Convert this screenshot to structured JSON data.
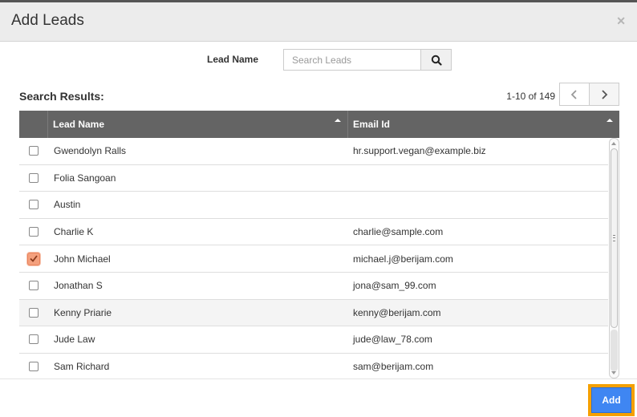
{
  "dialog": {
    "title": "Add Leads",
    "close_icon": "close-icon"
  },
  "search": {
    "label": "Lead Name",
    "placeholder": "Search Leads",
    "value": "",
    "button_icon": "search-icon"
  },
  "results": {
    "title": "Search Results:",
    "pagination": "1-10 of 149",
    "prev_icon": "chevron-left-icon",
    "next_icon": "chevron-right-icon"
  },
  "table": {
    "columns": [
      "Lead Name",
      "Email Id"
    ],
    "rows": [
      {
        "name": "Gwendolyn Ralls",
        "email": "hr.support.vegan@example.biz",
        "checked": false
      },
      {
        "name": "Folia Sangoan",
        "email": "",
        "checked": false
      },
      {
        "name": "Austin",
        "email": "",
        "checked": false
      },
      {
        "name": "Charlie K",
        "email": "charlie@sample.com",
        "checked": false
      },
      {
        "name": "John Michael",
        "email": "michael.j@berijam.com",
        "checked": true
      },
      {
        "name": "Jonathan S",
        "email": "jona@sam_99.com",
        "checked": false
      },
      {
        "name": "Kenny Priarie",
        "email": "kenny@berijam.com",
        "checked": false
      },
      {
        "name": "Jude Law",
        "email": "jude@law_78.com",
        "checked": false
      },
      {
        "name": "Sam Richard",
        "email": "sam@berijam.com",
        "checked": false
      }
    ]
  },
  "footer": {
    "add_label": "Add"
  },
  "colors": {
    "header_bg": "#646464",
    "checked_accent": "#f4a07d",
    "primary_button": "#3f86f2",
    "focus_outline": "#f5a000"
  }
}
